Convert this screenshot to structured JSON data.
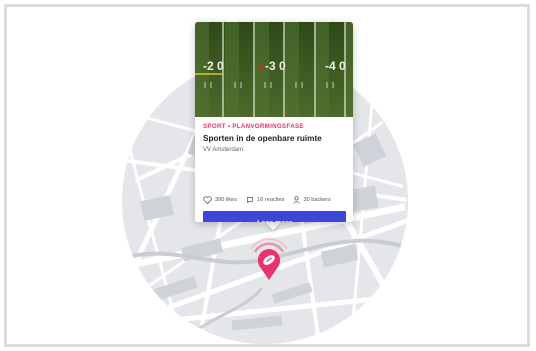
{
  "card": {
    "category": "SPORT • PLANVORMINGSFASE",
    "title": "Sporten in de openbare ruimte",
    "organization": "VV Amsterdam",
    "stats": {
      "likes": "300 likes",
      "reactions": "16 reacties",
      "backers": "30 backers"
    },
    "cta_label": "Lees meer",
    "image": {
      "field_numbers": [
        "-2 0",
        "-3 0",
        "-4 0"
      ]
    }
  },
  "colors": {
    "accent": "#e8336e",
    "button": "#3d46d9",
    "map_background": "#e4e6ea",
    "field_green": "#3f5a22"
  },
  "icons": {
    "likes": "heart-icon",
    "reactions": "speech-bubble-icon",
    "backers": "person-icon",
    "marker": "rugby-ball-marker-icon"
  }
}
